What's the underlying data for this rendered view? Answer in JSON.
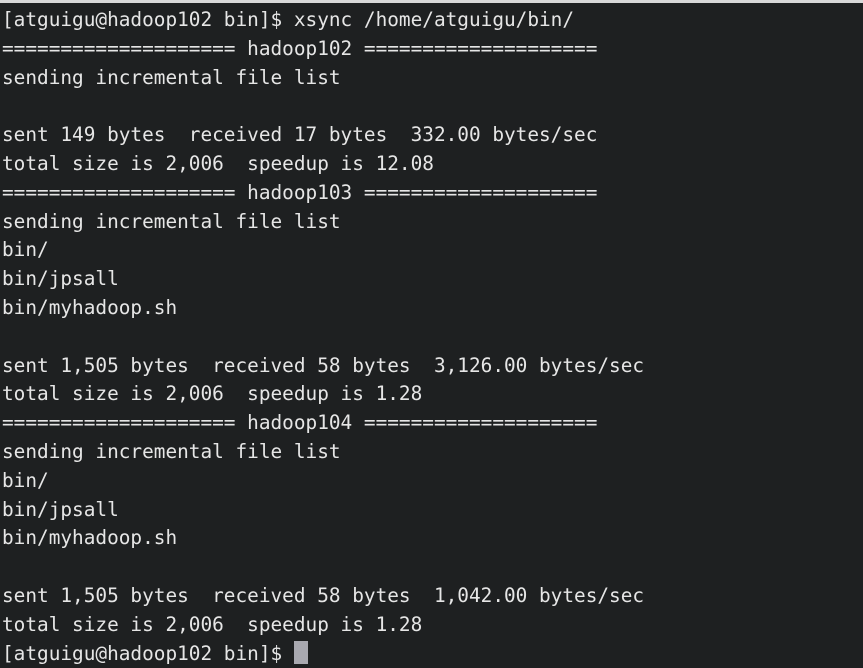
{
  "terminal": {
    "background_color": "#1e2021",
    "foreground_color": "#e6e6e6",
    "cursor_color": "#a9a9b0",
    "cursor_glyph": "block-cursor",
    "prompt": "[atguigu@hadoop102 bin]$",
    "command": "xsync /home/atguigu/bin/",
    "lines": [
      "[atguigu@hadoop102 bin]$ xsync /home/atguigu/bin/",
      "==================== hadoop102 ====================",
      "sending incremental file list",
      "",
      "sent 149 bytes  received 17 bytes  332.00 bytes/sec",
      "total size is 2,006  speedup is 12.08",
      "==================== hadoop103 ====================",
      "sending incremental file list",
      "bin/",
      "bin/jpsall",
      "bin/myhadoop.sh",
      "",
      "sent 1,505 bytes  received 58 bytes  3,126.00 bytes/sec",
      "total size is 2,006  speedup is 1.28",
      "==================== hadoop104 ====================",
      "sending incremental file list",
      "bin/",
      "bin/jpsall",
      "bin/myhadoop.sh",
      "",
      "sent 1,505 bytes  received 58 bytes  1,042.00 bytes/sec",
      "total size is 2,006  speedup is 1.28"
    ],
    "final_prompt": "[atguigu@hadoop102 bin]$ ",
    "hosts": [
      "hadoop102",
      "hadoop103",
      "hadoop104"
    ],
    "transfers": [
      {
        "host": "hadoop102",
        "sent_bytes": "149",
        "received_bytes": "17",
        "rate": "332.00 bytes/sec",
        "total_size": "2,006",
        "speedup": "12.08",
        "files": []
      },
      {
        "host": "hadoop103",
        "sent_bytes": "1,505",
        "received_bytes": "58",
        "rate": "3,126.00 bytes/sec",
        "total_size": "2,006",
        "speedup": "1.28",
        "files": [
          "bin/",
          "bin/jpsall",
          "bin/myhadoop.sh"
        ]
      },
      {
        "host": "hadoop104",
        "sent_bytes": "1,505",
        "received_bytes": "58",
        "rate": "1,042.00 bytes/sec",
        "total_size": "2,006",
        "speedup": "1.28",
        "files": [
          "bin/",
          "bin/jpsall",
          "bin/myhadoop.sh"
        ]
      }
    ]
  }
}
